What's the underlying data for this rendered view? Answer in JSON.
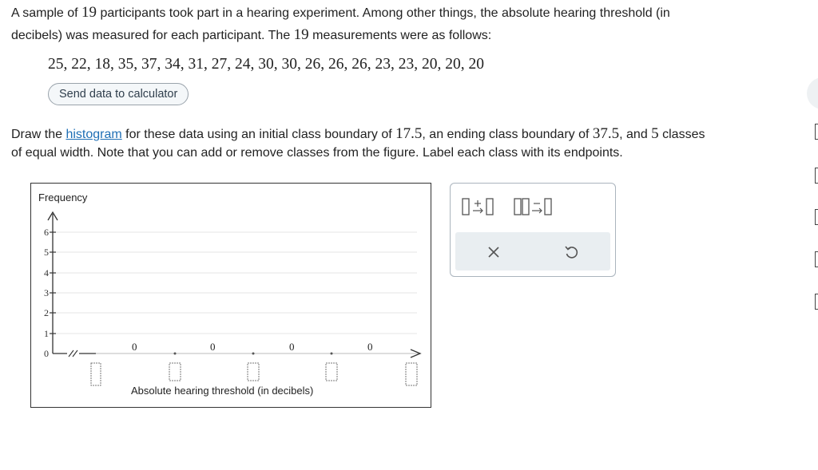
{
  "problem": {
    "intro_a": "A sample of ",
    "n": "19",
    "intro_b": " participants took part in a hearing experiment. Among other things, the absolute hearing threshold (in",
    "intro_c": "decibels) was measured for each participant. The ",
    "intro_d": " measurements were as follows:",
    "data_values": "25, 22, 18, 35, 37, 34, 31, 27, 24, 30, 30, 26, 26, 26, 23, 23, 20, 20, 20",
    "send_button": "Send data to calculator",
    "instr_a": "Draw the ",
    "instr_link": "histogram",
    "instr_b": " for these data using an initial class boundary of ",
    "start_boundary": "17.5",
    "instr_c": ", an ending class boundary of ",
    "end_boundary": "37.5",
    "instr_d": ", and ",
    "num_classes": "5",
    "instr_e": " classes",
    "instr_f": "of equal width. Note that you can add or remove classes from the figure. Label each class with its endpoints."
  },
  "graph": {
    "ylabel": "Frequency",
    "xlabel": "Absolute hearing threshold (in decibels)",
    "y_ticks": [
      "0",
      "1",
      "2",
      "3",
      "4",
      "5",
      "6"
    ],
    "bar_values": [
      "0",
      "0",
      "0",
      "0"
    ]
  },
  "toolbar": {
    "add_class_icon": "add-class-icon",
    "remove_class_icon": "remove-class-icon",
    "clear_icon": "x-icon",
    "undo_icon": "undo-icon"
  }
}
